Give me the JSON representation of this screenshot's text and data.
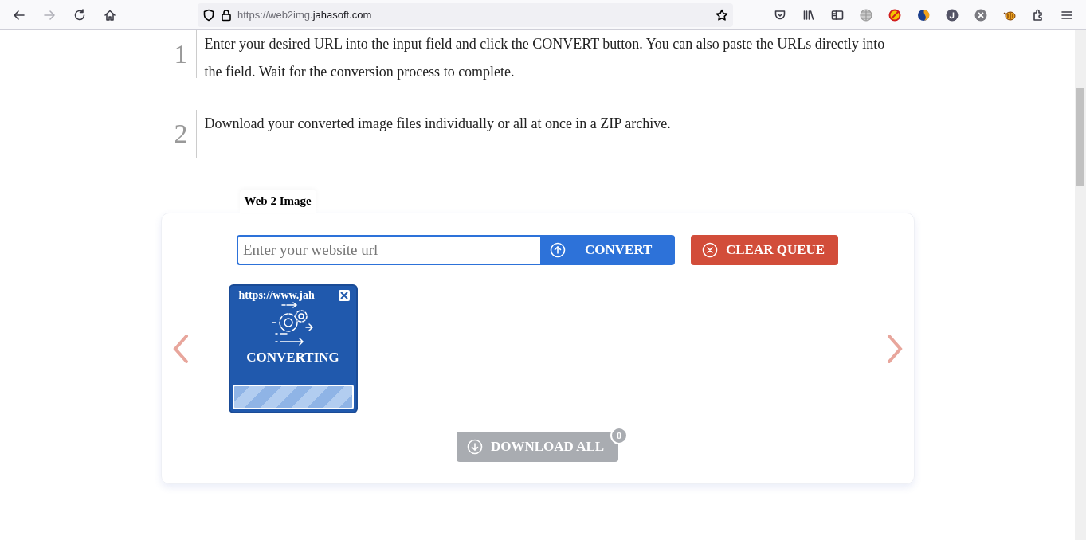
{
  "browser": {
    "url_prefix": "https://web2img.",
    "url_domain": "jahasoft.com",
    "forward_disabled": true
  },
  "steps": [
    {
      "number": "1",
      "text": "Enter your desired URL into the input field and click the CONVERT button. You can also paste the URLs directly into the field. Wait for the conversion process to complete."
    },
    {
      "number": "2",
      "text": "Download your converted image files individually or all at once in a ZIP archive."
    }
  ],
  "tool": {
    "tab": "Web 2 Image",
    "input": {
      "placeholder": "Enter your website url"
    },
    "convert_button": "CONVERT",
    "clear_button": "CLEAR QUEUE",
    "queue": [
      {
        "url": "https://www.jah",
        "status": "CONVERTING",
        "kind": "converting"
      }
    ],
    "download_button": {
      "label": "DOWNLOAD ALL",
      "count": "0",
      "disabled": true
    }
  }
}
